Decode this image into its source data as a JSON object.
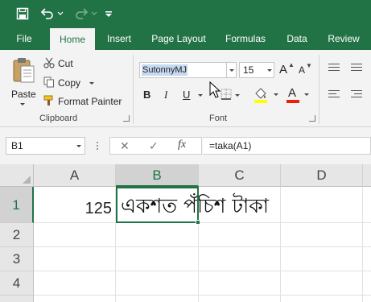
{
  "quick_access": {
    "save_icon": "save-icon",
    "undo_icon": "undo-icon",
    "redo_icon": "redo-icon",
    "customize_icon": "customize-icon"
  },
  "tabs": [
    {
      "label": "File",
      "active": false
    },
    {
      "label": "Home",
      "active": true
    },
    {
      "label": "Insert",
      "active": false
    },
    {
      "label": "Page Layout",
      "active": false
    },
    {
      "label": "Formulas",
      "active": false
    },
    {
      "label": "Data",
      "active": false
    },
    {
      "label": "Review",
      "active": false
    }
  ],
  "clipboard": {
    "paste_label": "Paste",
    "cut_label": "Cut",
    "copy_label": "Copy",
    "format_painter_label": "Format Painter",
    "group_label": "Clipboard"
  },
  "font": {
    "font_name": "SutonnyMJ",
    "font_size": "15",
    "bold_label": "B",
    "italic_label": "I",
    "underline_label": "U",
    "grow_label": "A",
    "shrink_label": "A",
    "font_color_label": "A",
    "group_label": "Font",
    "highlight_color": "#ffff00",
    "font_color": "#e8210d"
  },
  "formula_bar": {
    "name_box": "B1",
    "fx_label": "fx",
    "formula": "=taka(A1)"
  },
  "sheet": {
    "columns": [
      "A",
      "B",
      "C",
      "D"
    ],
    "rows": [
      "1",
      "2",
      "3",
      "4"
    ],
    "active_cell": "B1",
    "A1": "125",
    "B1": "একশত পঁচিশ টাকা"
  },
  "colors": {
    "accent": "#217346"
  }
}
